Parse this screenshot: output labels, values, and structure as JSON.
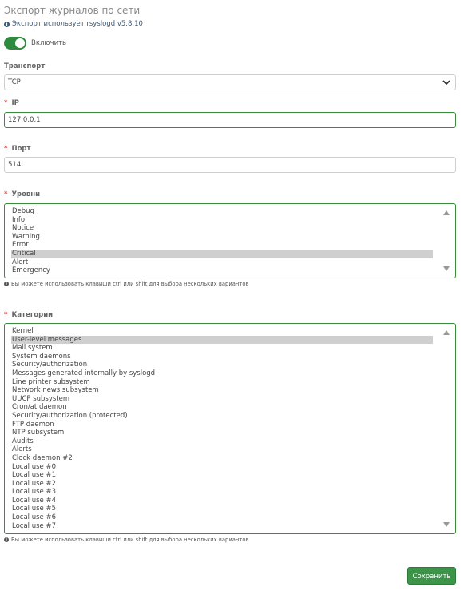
{
  "page": {
    "title": "Экспорт журналов по сети",
    "info": "Экспорт использует rsyslogd v5.8.10",
    "enable_label": "Включить"
  },
  "transport": {
    "label": "Транспорт",
    "value": "TCP"
  },
  "ip": {
    "required_mark": "*",
    "label": "IP",
    "value": "127.0.0.1"
  },
  "port": {
    "required_mark": "*",
    "label": "Порт",
    "value": "514"
  },
  "levels": {
    "required_mark": "*",
    "label": "Уровни",
    "options": [
      "Debug",
      "Info",
      "Notice",
      "Warning",
      "Error",
      "Critical",
      "Alert",
      "Emergency"
    ],
    "selected": "Critical",
    "hint": "Вы можете использовать клавиши ctrl или shift для выбора нескольких вариантов"
  },
  "categories": {
    "required_mark": "*",
    "label": "Категории",
    "options": [
      "Kernel",
      "User-level messages",
      "Mail system",
      "System daemons",
      "Security/authorization",
      "Messages generated internally by syslogd",
      "Line printer subsystem",
      "Network news subsystem",
      "UUCP subsystem",
      "Cron/at daemon",
      "Security/authorization (protected)",
      "FTP daemon",
      "NTP subsystem",
      "Audits",
      "Alerts",
      "Clock daemon #2",
      "Local use #0",
      "Local use #1",
      "Local use #2",
      "Local use #3",
      "Local use #4",
      "Local use #5",
      "Local use #6",
      "Local use #7"
    ],
    "selected": "User-level messages",
    "hint": "Вы можете использовать клавиши ctrl или shift для выбора нескольких вариантов"
  },
  "save_label": "Сохранить",
  "colors": {
    "accent": "#3b9447",
    "required": "#d43f3a",
    "selected_option": "#cfcfcf"
  }
}
